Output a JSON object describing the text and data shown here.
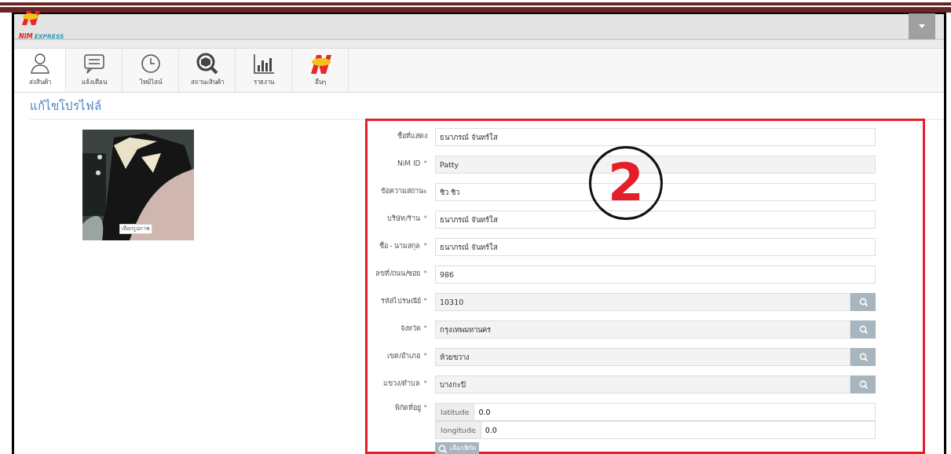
{
  "header": {
    "logo_main": "NIM",
    "logo_sub": "EXPRESS"
  },
  "tabs": [
    {
      "label": "ส่งสินค้า",
      "selected": true
    },
    {
      "label": "แจ้งเตือน",
      "selected": false
    },
    {
      "label": "ไทม์ไลน์",
      "selected": false
    },
    {
      "label": "สถานะสินค้า",
      "selected": false
    },
    {
      "label": "รายงาน",
      "selected": false
    },
    {
      "label": "อื่นๆ",
      "selected": false
    }
  ],
  "page_title": "แก้ไขโปรไฟล์",
  "photo": {
    "kind": "picture",
    "button": "เลือกรูปภาพ"
  },
  "annotation": {
    "label": "2"
  },
  "form": {
    "fields": [
      {
        "label": "ชื่อที่แสดง",
        "value": "ธนาภรณ์ จันทร์ใส",
        "kind": "text",
        "readonly": false
      },
      {
        "label": "NiM ID",
        "required_mark": "*",
        "value": "Patty",
        "kind": "text",
        "readonly": true
      },
      {
        "label": "ข้อความสถานะ",
        "value": "ชิว ชิว",
        "kind": "text",
        "readonly": false
      },
      {
        "label": "บริษัท/ร้าน",
        "required_mark": "*",
        "value": "ธนาภรณ์ จันทร์ใส",
        "kind": "text",
        "readonly": false
      },
      {
        "label": "ชื่อ - นามสกุล",
        "required_mark": "*",
        "value": "ธนาภรณ์ จันทร์ใส",
        "kind": "text",
        "readonly": false
      },
      {
        "label": "ลขที่/ถนน/ซอย",
        "required_mark": "*",
        "value": "986",
        "kind": "text",
        "readonly": false
      },
      {
        "label": "รหัสไปรษณีย์",
        "required_mark": "*",
        "value": "10310",
        "kind": "lookup",
        "readonly": true
      },
      {
        "label": "จังหวัด",
        "required_mark": "*",
        "value": "กรุงเทพมหานคร",
        "kind": "lookup",
        "readonly": true
      },
      {
        "label": "เขต/อำเภอ",
        "required_mark": "*",
        "value": "ห้วยขวาง",
        "kind": "lookup",
        "readonly": true
      },
      {
        "label": "แขวง/ตำบล",
        "required_mark": "*",
        "value": "บางกะปิ",
        "kind": "lookup",
        "readonly": true
      }
    ],
    "location": {
      "label": "พิกัดที่อยู่",
      "required_mark": "*",
      "coords": [
        {
          "addon": "latitude",
          "value": "0.0"
        },
        {
          "addon": "longitude",
          "value": "0.0"
        }
      ],
      "button": "เลือกพิกัด"
    }
  }
}
